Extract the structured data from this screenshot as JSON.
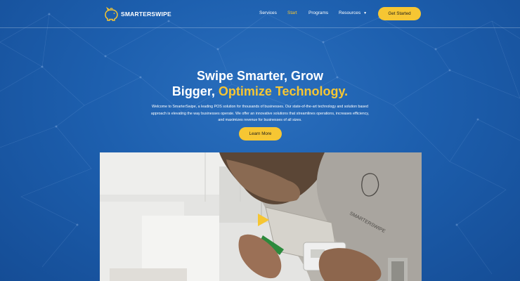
{
  "brand": {
    "name": "SMARTERSWIPE"
  },
  "nav": {
    "items": [
      {
        "label": "Services",
        "active": false
      },
      {
        "label": "Start",
        "active": true
      },
      {
        "label": "Programs",
        "active": false
      },
      {
        "label": "Resources",
        "active": false,
        "has_dropdown": true
      }
    ],
    "cta_label": "Get Started"
  },
  "hero": {
    "title_line1": "Swipe Smarter, Grow",
    "title_line2_plain": "Bigger, ",
    "title_line2_accent": "Optimize Technology.",
    "body_line1": "Welcome to SmarterSwipe, a leading POS solution for thousands of businesses. Our state-of-the-art technology and solution based",
    "body_line2": "approach is elevating the way businesses operate. We offer an innovative solutions that streamlines operations, increases efficiency,",
    "body_line3": "and maximizes revenue for businesses of all sizes.",
    "button_label": "Learn More"
  },
  "video": {
    "shirt_text": "SMARTERSWIPE"
  },
  "colors": {
    "accent": "#f6c633",
    "background": "#1d5fae",
    "text": "#ffffff"
  },
  "icons": {
    "logo": "piggy-bank-icon",
    "play": "play-icon",
    "dropdown": "chevron-down-icon"
  }
}
